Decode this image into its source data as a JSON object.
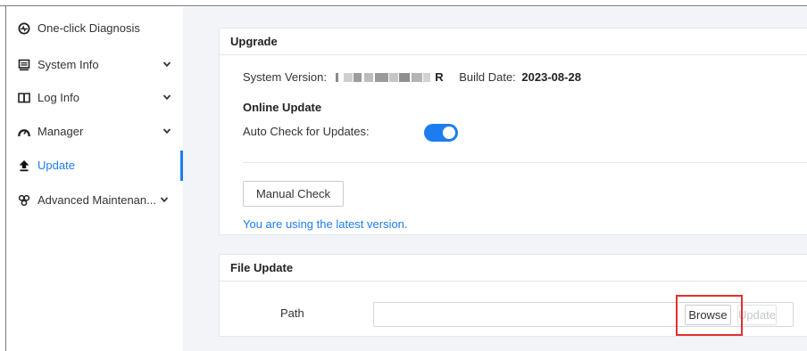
{
  "sidebar": {
    "items": [
      {
        "label": "One-click Diagnosis",
        "icon": "diagnosis-icon",
        "has_submenu": false,
        "active": false
      },
      {
        "label": "System Info",
        "icon": "monitor-icon",
        "has_submenu": true,
        "active": false
      },
      {
        "label": "Log Info",
        "icon": "book-icon",
        "has_submenu": true,
        "active": false
      },
      {
        "label": "Manager",
        "icon": "gauge-icon",
        "has_submenu": true,
        "active": false
      },
      {
        "label": "Update",
        "icon": "upload-arrow-icon",
        "has_submenu": false,
        "active": true
      },
      {
        "label": "Advanced Maintenan...",
        "icon": "tools-icon",
        "has_submenu": true,
        "active": false
      }
    ]
  },
  "upgrade": {
    "title": "Upgrade",
    "system_version_label": "System Version:",
    "system_version_suffix": "R",
    "build_date_label": "Build Date:",
    "build_date_value": "2023-08-28",
    "online_update_title": "Online Update",
    "auto_check_label": "Auto Check for Updates:",
    "auto_check_enabled": true,
    "manual_check_label": "Manual Check",
    "status_message": "You are using the latest version."
  },
  "file_update": {
    "title": "File Update",
    "path_label": "Path",
    "path_value": "",
    "browse_label": "Browse",
    "update_label": "Update"
  },
  "colors": {
    "accent": "#1d7df0",
    "highlight": "#e0312e",
    "content_bg": "#f3f4f7"
  }
}
